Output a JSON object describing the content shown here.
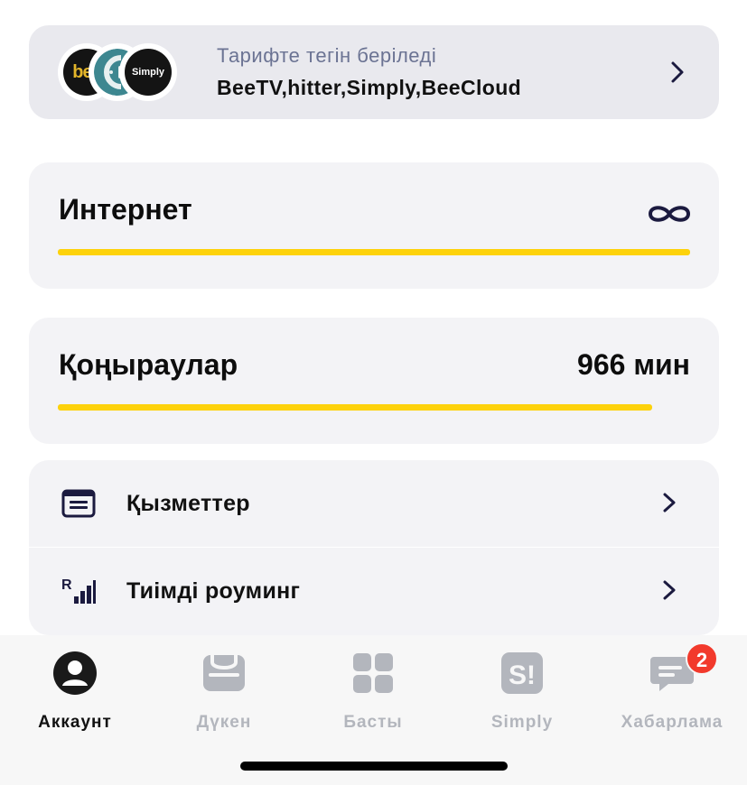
{
  "promo": {
    "subtitle": "Тарифте тегін беріледі",
    "title": "BeeTV,hitter,Simply,BeeCloud",
    "logos": [
      {
        "name": "beetv-logo",
        "text": "bee"
      },
      {
        "name": "hitter-logo",
        "text": ""
      },
      {
        "name": "simply-logo",
        "text": "Simply"
      }
    ]
  },
  "internet": {
    "title": "Интернет",
    "value_icon": "infinity-icon",
    "progress": 1.0
  },
  "calls": {
    "title": "Қоңыраулар",
    "value": "966 мин",
    "progress": 0.94
  },
  "list": {
    "items": [
      {
        "label": "Қызметтер",
        "icon": "services-icon"
      },
      {
        "label": "Тиімді роуминг",
        "icon": "roaming-signal-icon"
      }
    ]
  },
  "tabbar": {
    "tabs": [
      {
        "label": "Аккаунт",
        "icon": "account-icon",
        "active": true
      },
      {
        "label": "Дүкен",
        "icon": "shop-icon",
        "active": false
      },
      {
        "label": "Басты",
        "icon": "home-grid-icon",
        "active": false
      },
      {
        "label": "Simply",
        "icon": "simply-icon",
        "active": false
      },
      {
        "label": "Хабарлама",
        "icon": "messages-icon",
        "active": false,
        "badge": "2"
      }
    ]
  },
  "colors": {
    "accent": "#fdd20b",
    "card_bg": "#f3f3f6",
    "promo_bg": "#e9e9ee",
    "badge": "#f23a2c",
    "icon_dark": "#1b1a3f",
    "inactive": "#b3b6bd"
  }
}
